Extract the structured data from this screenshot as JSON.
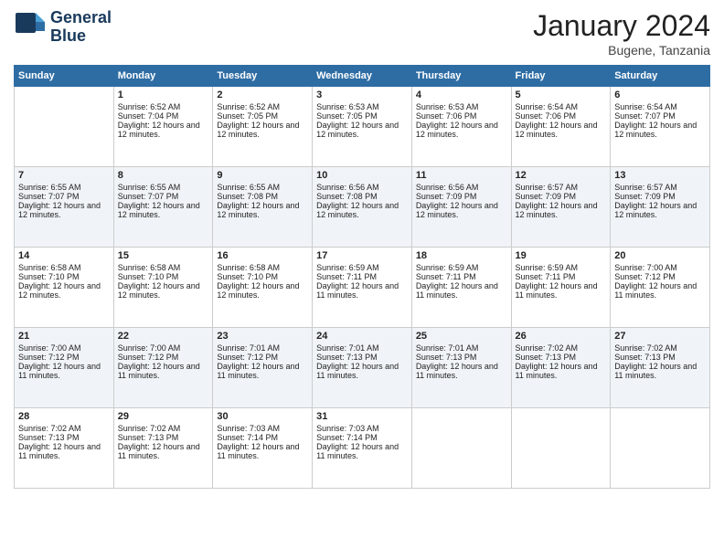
{
  "logo": {
    "line1": "General",
    "line2": "Blue"
  },
  "title": "January 2024",
  "location": "Bugene, Tanzania",
  "days_of_week": [
    "Sunday",
    "Monday",
    "Tuesday",
    "Wednesday",
    "Thursday",
    "Friday",
    "Saturday"
  ],
  "weeks": [
    [
      {
        "day": "",
        "sunrise": "",
        "sunset": "",
        "daylight": ""
      },
      {
        "day": "1",
        "sunrise": "Sunrise: 6:52 AM",
        "sunset": "Sunset: 7:04 PM",
        "daylight": "Daylight: 12 hours and 12 minutes."
      },
      {
        "day": "2",
        "sunrise": "Sunrise: 6:52 AM",
        "sunset": "Sunset: 7:05 PM",
        "daylight": "Daylight: 12 hours and 12 minutes."
      },
      {
        "day": "3",
        "sunrise": "Sunrise: 6:53 AM",
        "sunset": "Sunset: 7:05 PM",
        "daylight": "Daylight: 12 hours and 12 minutes."
      },
      {
        "day": "4",
        "sunrise": "Sunrise: 6:53 AM",
        "sunset": "Sunset: 7:06 PM",
        "daylight": "Daylight: 12 hours and 12 minutes."
      },
      {
        "day": "5",
        "sunrise": "Sunrise: 6:54 AM",
        "sunset": "Sunset: 7:06 PM",
        "daylight": "Daylight: 12 hours and 12 minutes."
      },
      {
        "day": "6",
        "sunrise": "Sunrise: 6:54 AM",
        "sunset": "Sunset: 7:07 PM",
        "daylight": "Daylight: 12 hours and 12 minutes."
      }
    ],
    [
      {
        "day": "7",
        "sunrise": "Sunrise: 6:55 AM",
        "sunset": "Sunset: 7:07 PM",
        "daylight": "Daylight: 12 hours and 12 minutes."
      },
      {
        "day": "8",
        "sunrise": "Sunrise: 6:55 AM",
        "sunset": "Sunset: 7:07 PM",
        "daylight": "Daylight: 12 hours and 12 minutes."
      },
      {
        "day": "9",
        "sunrise": "Sunrise: 6:55 AM",
        "sunset": "Sunset: 7:08 PM",
        "daylight": "Daylight: 12 hours and 12 minutes."
      },
      {
        "day": "10",
        "sunrise": "Sunrise: 6:56 AM",
        "sunset": "Sunset: 7:08 PM",
        "daylight": "Daylight: 12 hours and 12 minutes."
      },
      {
        "day": "11",
        "sunrise": "Sunrise: 6:56 AM",
        "sunset": "Sunset: 7:09 PM",
        "daylight": "Daylight: 12 hours and 12 minutes."
      },
      {
        "day": "12",
        "sunrise": "Sunrise: 6:57 AM",
        "sunset": "Sunset: 7:09 PM",
        "daylight": "Daylight: 12 hours and 12 minutes."
      },
      {
        "day": "13",
        "sunrise": "Sunrise: 6:57 AM",
        "sunset": "Sunset: 7:09 PM",
        "daylight": "Daylight: 12 hours and 12 minutes."
      }
    ],
    [
      {
        "day": "14",
        "sunrise": "Sunrise: 6:58 AM",
        "sunset": "Sunset: 7:10 PM",
        "daylight": "Daylight: 12 hours and 12 minutes."
      },
      {
        "day": "15",
        "sunrise": "Sunrise: 6:58 AM",
        "sunset": "Sunset: 7:10 PM",
        "daylight": "Daylight: 12 hours and 12 minutes."
      },
      {
        "day": "16",
        "sunrise": "Sunrise: 6:58 AM",
        "sunset": "Sunset: 7:10 PM",
        "daylight": "Daylight: 12 hours and 12 minutes."
      },
      {
        "day": "17",
        "sunrise": "Sunrise: 6:59 AM",
        "sunset": "Sunset: 7:11 PM",
        "daylight": "Daylight: 12 hours and 11 minutes."
      },
      {
        "day": "18",
        "sunrise": "Sunrise: 6:59 AM",
        "sunset": "Sunset: 7:11 PM",
        "daylight": "Daylight: 12 hours and 11 minutes."
      },
      {
        "day": "19",
        "sunrise": "Sunrise: 6:59 AM",
        "sunset": "Sunset: 7:11 PM",
        "daylight": "Daylight: 12 hours and 11 minutes."
      },
      {
        "day": "20",
        "sunrise": "Sunrise: 7:00 AM",
        "sunset": "Sunset: 7:12 PM",
        "daylight": "Daylight: 12 hours and 11 minutes."
      }
    ],
    [
      {
        "day": "21",
        "sunrise": "Sunrise: 7:00 AM",
        "sunset": "Sunset: 7:12 PM",
        "daylight": "Daylight: 12 hours and 11 minutes."
      },
      {
        "day": "22",
        "sunrise": "Sunrise: 7:00 AM",
        "sunset": "Sunset: 7:12 PM",
        "daylight": "Daylight: 12 hours and 11 minutes."
      },
      {
        "day": "23",
        "sunrise": "Sunrise: 7:01 AM",
        "sunset": "Sunset: 7:12 PM",
        "daylight": "Daylight: 12 hours and 11 minutes."
      },
      {
        "day": "24",
        "sunrise": "Sunrise: 7:01 AM",
        "sunset": "Sunset: 7:13 PM",
        "daylight": "Daylight: 12 hours and 11 minutes."
      },
      {
        "day": "25",
        "sunrise": "Sunrise: 7:01 AM",
        "sunset": "Sunset: 7:13 PM",
        "daylight": "Daylight: 12 hours and 11 minutes."
      },
      {
        "day": "26",
        "sunrise": "Sunrise: 7:02 AM",
        "sunset": "Sunset: 7:13 PM",
        "daylight": "Daylight: 12 hours and 11 minutes."
      },
      {
        "day": "27",
        "sunrise": "Sunrise: 7:02 AM",
        "sunset": "Sunset: 7:13 PM",
        "daylight": "Daylight: 12 hours and 11 minutes."
      }
    ],
    [
      {
        "day": "28",
        "sunrise": "Sunrise: 7:02 AM",
        "sunset": "Sunset: 7:13 PM",
        "daylight": "Daylight: 12 hours and 11 minutes."
      },
      {
        "day": "29",
        "sunrise": "Sunrise: 7:02 AM",
        "sunset": "Sunset: 7:13 PM",
        "daylight": "Daylight: 12 hours and 11 minutes."
      },
      {
        "day": "30",
        "sunrise": "Sunrise: 7:03 AM",
        "sunset": "Sunset: 7:14 PM",
        "daylight": "Daylight: 12 hours and 11 minutes."
      },
      {
        "day": "31",
        "sunrise": "Sunrise: 7:03 AM",
        "sunset": "Sunset: 7:14 PM",
        "daylight": "Daylight: 12 hours and 11 minutes."
      },
      {
        "day": "",
        "sunrise": "",
        "sunset": "",
        "daylight": ""
      },
      {
        "day": "",
        "sunrise": "",
        "sunset": "",
        "daylight": ""
      },
      {
        "day": "",
        "sunrise": "",
        "sunset": "",
        "daylight": ""
      }
    ]
  ]
}
